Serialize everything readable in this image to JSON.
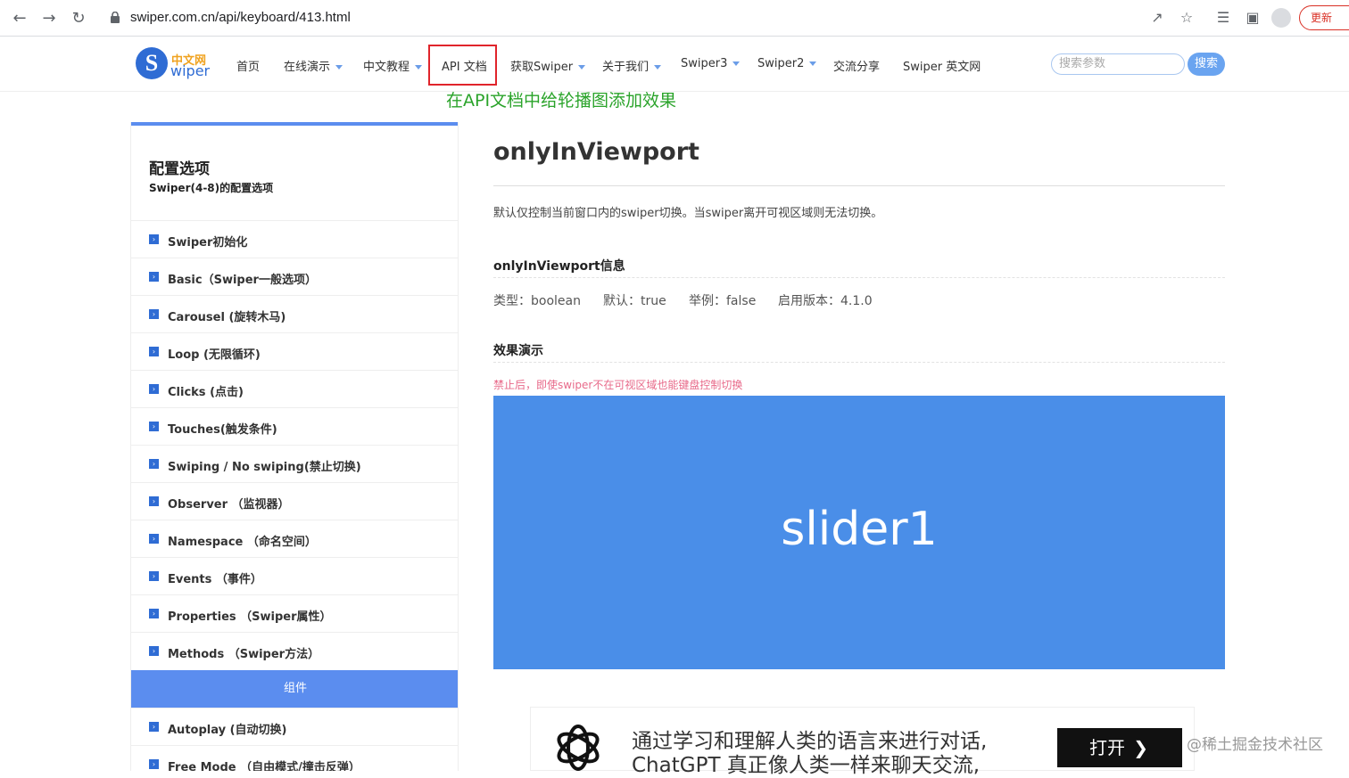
{
  "browser": {
    "url": "swiper.com.cn/api/keyboard/413.html",
    "update_label": "更新",
    "icons": [
      "back-icon",
      "forward-icon",
      "reload-icon",
      "lock-icon",
      "share-icon",
      "star-icon",
      "reading-list-icon",
      "sidebar-icon",
      "profile-icon"
    ]
  },
  "header": {
    "logo_cn": "中文网",
    "logo_en": "wiper",
    "logo_letter": "S",
    "menu": [
      {
        "label": "首页",
        "dropdown": false
      },
      {
        "label": "在线演示",
        "dropdown": true
      },
      {
        "label": "中文教程",
        "dropdown": true
      },
      {
        "label": "API 文档",
        "dropdown": false
      },
      {
        "label": "获取Swiper",
        "dropdown": true
      },
      {
        "label": "关于我们",
        "dropdown": true
      },
      {
        "label": "Swiper3",
        "dropdown": true
      },
      {
        "label": "Swiper2",
        "dropdown": true
      },
      {
        "label": "交流分享",
        "dropdown": false
      },
      {
        "label": "Swiper 英文网",
        "dropdown": false
      }
    ],
    "search_placeholder": "搜索参数",
    "search_button": "搜索"
  },
  "annotation": "在API文档中给轮播图添加效果",
  "sidebar": {
    "title": "配置选项",
    "subtitle": "Swiper(4-8)的配置选项",
    "items": [
      "Swiper初始化",
      "Basic（Swiper一般选项）",
      "Carousel (旋转木马)",
      "Loop (无限循环)",
      "Clicks (点击)",
      "Touches(触发条件)",
      "Swiping / No swiping(禁止切换)",
      "Observer （监视器）",
      "Namespace （命名空间）",
      "Events （事件）",
      "Properties （Swiper属性）",
      "Methods （Swiper方法）"
    ],
    "section": "组件",
    "items2": [
      "Autoplay (自动切换)",
      "Free Mode （自由模式/撞击反弹）"
    ]
  },
  "main": {
    "title": "onlyInViewport",
    "description": "默认仅控制当前窗口内的swiper切换。当swiper离开可视区域则无法切换。",
    "info_heading": "onlyInViewport信息",
    "info": {
      "type": "类型：boolean",
      "default": "默认：true",
      "example": "举例：false",
      "version": "启用版本：4.1.0"
    },
    "demo_heading": "效果演示",
    "demo_note": "禁止后，即使swiper不在可视区域也能键盘控制切换",
    "slide_text": "slider1"
  },
  "ad": {
    "line1": "通过学习和理解人类的语言来进行对话,",
    "line2": "ChatGPT 真正像人类一样来聊天交流,",
    "open_label": "打开",
    "watermark": "@稀土掘金技术社区"
  },
  "colors": {
    "accent": "#5b8def",
    "slider": "#4a8ee8",
    "annotation": "#2aa32a",
    "highlight_box": "#e0242b",
    "demo_note": "#e86a8a"
  }
}
